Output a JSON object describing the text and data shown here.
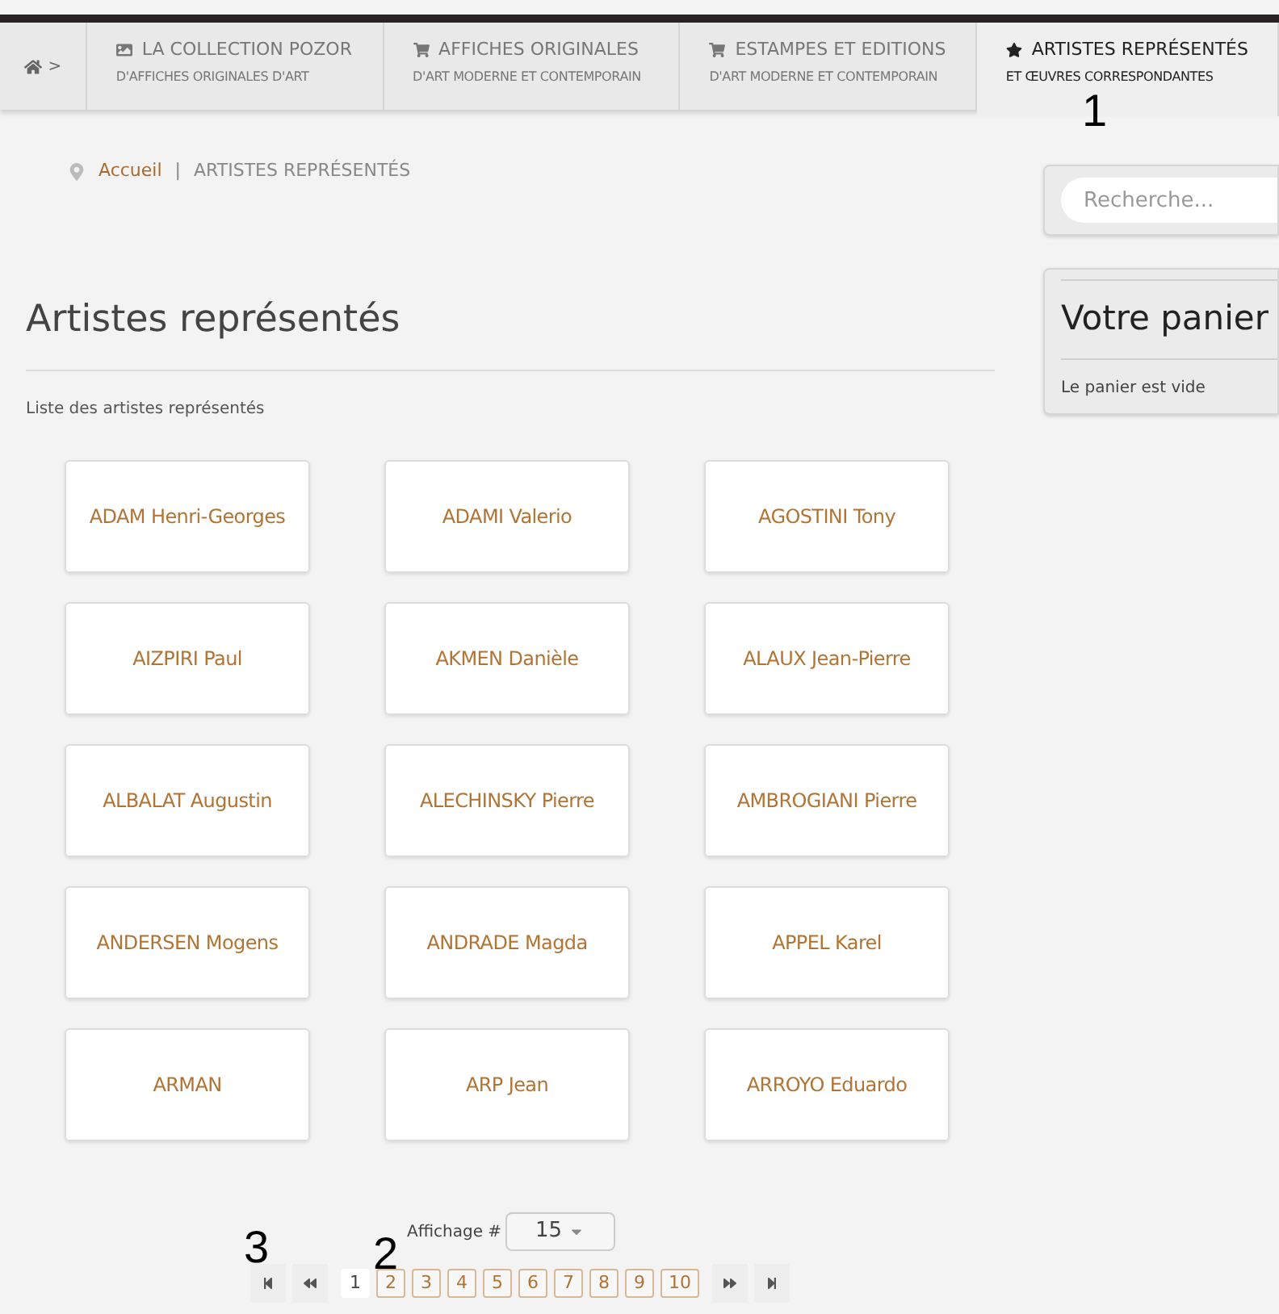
{
  "nav": {
    "home_separator": ">",
    "items": [
      {
        "title": "LA COLLECTION POZOR",
        "subtitle": "D'AFFICHES ORIGINALES D'ART",
        "selected": false
      },
      {
        "title": "AFFICHES ORIGINALES",
        "subtitle": "D'ART MODERNE ET CONTEMPORAIN",
        "selected": false
      },
      {
        "title": "ESTAMPES ET EDITIONS",
        "subtitle": "D'ART MODERNE ET CONTEMPORAIN",
        "selected": false
      },
      {
        "title": "ARTISTES REPRÉSENTÉS",
        "subtitle": "ET ŒUVRES CORRESPONDANTES",
        "selected": true
      }
    ]
  },
  "breadcrumb": {
    "link": "Accueil",
    "separator": "|",
    "current": "ARTISTES REPRÉSENTÉS"
  },
  "page": {
    "title": "Artistes représentés",
    "subtitle": "Liste des artistes représentés"
  },
  "artists": [
    "ADAM Henri-Georges",
    "ADAMI Valerio",
    "AGOSTINI Tony",
    "AIZPIRI Paul",
    "AKMEN Danièle",
    "ALAUX Jean-Pierre",
    "ALBALAT Augustin",
    "ALECHINSKY Pierre",
    "AMBROGIANI Pierre",
    "ANDERSEN Mogens",
    "ANDRADE Magda",
    "APPEL Karel",
    "ARMAN",
    "ARP Jean",
    "ARROYO Eduardo"
  ],
  "display": {
    "label": "Affichage #",
    "value": "15"
  },
  "pagination": {
    "pages": [
      {
        "label": "1",
        "selected": true
      },
      {
        "label": "2",
        "selected": false
      },
      {
        "label": "3",
        "selected": false
      },
      {
        "label": "4",
        "selected": false
      },
      {
        "label": "5",
        "selected": false
      },
      {
        "label": "6",
        "selected": false
      },
      {
        "label": "7",
        "selected": false
      },
      {
        "label": "8",
        "selected": false
      },
      {
        "label": "9",
        "selected": false
      },
      {
        "label": "10",
        "selected": false
      }
    ]
  },
  "sidebar": {
    "search": {
      "placeholder": "Recherche..."
    },
    "cart": {
      "title": "Votre panier",
      "text": "Le panier est vide"
    }
  },
  "annotations": [
    "1",
    "2",
    "3"
  ]
}
